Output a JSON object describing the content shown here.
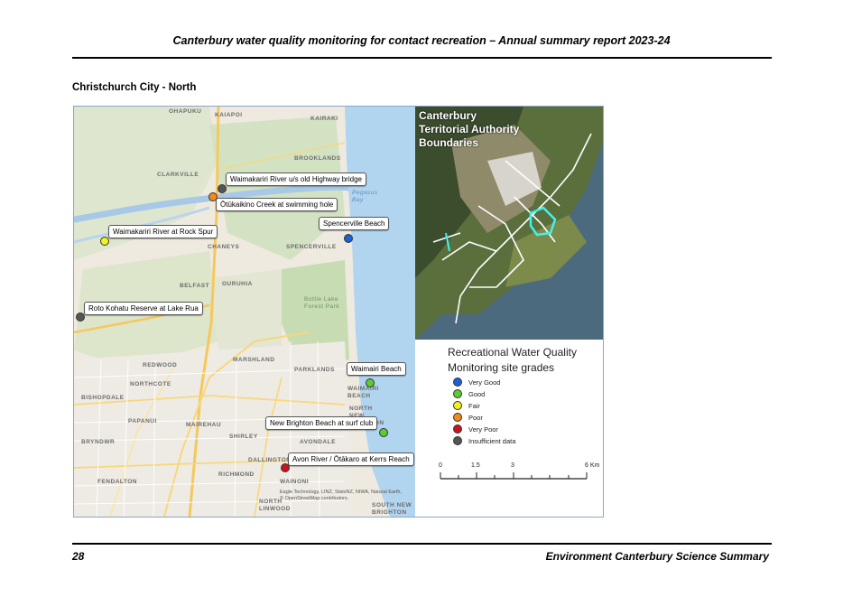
{
  "header": {
    "title": "Canterbury water quality monitoring for contact recreation – Annual summary report 2023-24"
  },
  "section": {
    "title": "Christchurch City - North"
  },
  "map": {
    "places": [
      "OHAPUKU",
      "KAIAPOI",
      "KAIRAKI",
      "BROOKLANDS",
      "CLARKVILLE",
      "CHANEYS",
      "SPENCERVILLE",
      "BELFAST",
      "OURUHIA",
      "MARSHLAND",
      "REDWOOD",
      "PARKLANDS",
      "NORTHCOTE",
      "BISHOPDALE",
      "WAIMAIRI BEACH",
      "NORTH NEW BRIGHTON",
      "PAPANUI",
      "MAIREHAU",
      "BRYNDWR",
      "AVONDALE",
      "SHIRLEY",
      "DALLINGTON",
      "FENDALTON",
      "RICHMOND",
      "WAINONI",
      "NORTH LINWOOD",
      "SOUTH NEW BRIGHTON",
      "Pegasus Bay",
      "Bottle Lake Forest Park"
    ],
    "sites": [
      {
        "label": "Waimakariri River u/s old Highway bridge",
        "grade": "Insufficient data"
      },
      {
        "label": "Ōtūkaikino Creek at swimming hole",
        "grade": "Poor"
      },
      {
        "label": "Spencerville Beach",
        "grade": "Very Good"
      },
      {
        "label": "Waimakariri River at Rock Spur",
        "grade": "Fair"
      },
      {
        "label": "Roto Kohatu Reserve at Lake Rua",
        "grade": "Insufficient data"
      },
      {
        "label": "Waimairi Beach",
        "grade": "Good"
      },
      {
        "label": "New Brighton Beach at surf club",
        "grade": "Good"
      },
      {
        "label": "Avon River / Ōtākaro at Kerrs Reach",
        "grade": "Very Poor"
      }
    ],
    "attribution": "Eagle Technology, LINZ, StatsNZ, NIWA, Natural Earth, © OpenStreetMap contributors."
  },
  "inset": {
    "title": "Canterbury Territorial Authority Boundaries"
  },
  "legend": {
    "title_line1": "Recreational Water Quality",
    "title_line2": "Monitoring site grades",
    "items": [
      {
        "label": "Very Good",
        "color": "#1f5fd6"
      },
      {
        "label": "Good",
        "color": "#5ccd2e"
      },
      {
        "label": "Fair",
        "color": "#f2f020"
      },
      {
        "label": "Poor",
        "color": "#f08a1c"
      },
      {
        "label": "Very Poor",
        "color": "#c8141e"
      },
      {
        "label": "Insufficient data",
        "color": "#555555"
      }
    ],
    "scale": {
      "ticks": [
        "0",
        "1.5",
        "3",
        "6 Km"
      ]
    }
  },
  "footer": {
    "page_number": "28",
    "title": "Environment Canterbury Science Summary"
  }
}
